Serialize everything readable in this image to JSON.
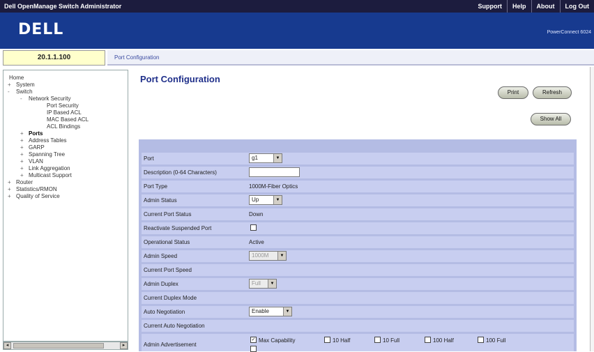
{
  "app": {
    "title": "Dell OpenManage Switch Administrator",
    "nav_links": [
      "Support",
      "Help",
      "About",
      "Log Out"
    ],
    "logo": "DELL",
    "product": "PowerConnect 6024"
  },
  "address": {
    "ip": "20.1.1.100",
    "breadcrumb": "Port Configuration"
  },
  "tree": [
    {
      "label": "Home"
    },
    {
      "label": "System",
      "exp": "+"
    },
    {
      "label": "Switch",
      "exp": "-"
    },
    {
      "label": "Network Security",
      "exp": "-"
    },
    {
      "label": "Port Security"
    },
    {
      "label": "IP Based ACL"
    },
    {
      "label": "MAC Based ACL"
    },
    {
      "label": "ACL Bindings"
    },
    {
      "label": "Ports",
      "exp": "+",
      "selected": true
    },
    {
      "label": "Address Tables",
      "exp": "+"
    },
    {
      "label": "GARP",
      "exp": "+"
    },
    {
      "label": "Spanning Tree",
      "exp": "+"
    },
    {
      "label": "VLAN",
      "exp": "+"
    },
    {
      "label": "Link Aggregation",
      "exp": "+"
    },
    {
      "label": "Multicast Support",
      "exp": "+"
    },
    {
      "label": "Router",
      "exp": "+"
    },
    {
      "label": "Statistics/RMON",
      "exp": "+"
    },
    {
      "label": "Quality of Service",
      "exp": "+"
    }
  ],
  "page": {
    "title": "Port Configuration",
    "print_label": "Print",
    "refresh_label": "Refresh",
    "show_all_label": "Show All"
  },
  "form": {
    "port": {
      "label": "Port",
      "value": "g1"
    },
    "description": {
      "label": "Description (0-64 Characters)",
      "value": ""
    },
    "port_type": {
      "label": "Port Type",
      "value": "1000M-Fiber Optics"
    },
    "admin_status": {
      "label": "Admin Status",
      "value": "Up"
    },
    "current_port_status": {
      "label": "Current Port Status",
      "value": "Down"
    },
    "reactivate": {
      "label": "Reactivate Suspended Port"
    },
    "operational_status": {
      "label": "Operational Status",
      "value": "Active"
    },
    "admin_speed": {
      "label": "Admin Speed",
      "value": "1000M"
    },
    "current_port_speed": {
      "label": "Current Port Speed",
      "value": ""
    },
    "admin_duplex": {
      "label": "Admin Duplex",
      "value": "Full"
    },
    "current_duplex_mode": {
      "label": "Current Duplex Mode",
      "value": ""
    },
    "auto_negotiation": {
      "label": "Auto Negotiation",
      "value": "Enable"
    },
    "current_auto_negotiation": {
      "label": "Current Auto Negotiation",
      "value": ""
    },
    "admin_advertisement": {
      "label": "Admin Advertisement",
      "options": [
        {
          "label": "Max Capability",
          "checked": true
        },
        {
          "label": "10 Half",
          "checked": false
        },
        {
          "label": "10 Full",
          "checked": false
        },
        {
          "label": "100 Half",
          "checked": false
        },
        {
          "label": "100 Full",
          "checked": false
        }
      ]
    }
  },
  "colors": {
    "brand": "#173a8f",
    "topbar": "#1c1c3e",
    "panel": "#b4bce4",
    "row": "#c8cef0",
    "title": "#1f2f8a"
  }
}
